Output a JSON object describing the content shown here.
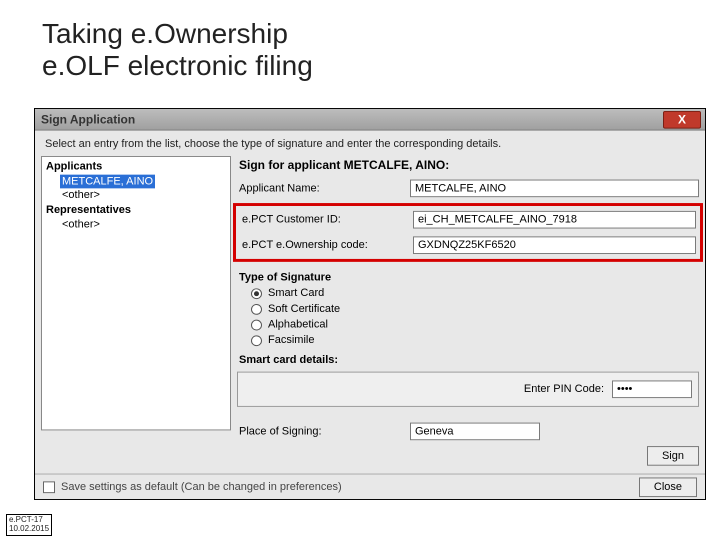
{
  "slide": {
    "title_line1": "Taking e.Ownership",
    "title_line2": "e.OLF electronic filing"
  },
  "window": {
    "title": "Sign Application",
    "instruction": "Select an entry from the list, choose the type of signature and enter the corresponding details."
  },
  "tree": {
    "applicants_label": "Applicants",
    "applicant_selected": "METCALFE, AINO",
    "other": "<other>",
    "reps_label": "Representatives"
  },
  "sign": {
    "heading": "Sign for applicant METCALFE, AINO:",
    "applicant_name_label": "Applicant Name:",
    "applicant_name_value": "METCALFE, AINO",
    "customer_id_label": "e.PCT Customer ID:",
    "customer_id_value": "ei_CH_METCALFE_AINO_7918",
    "ownership_code_label": "e.PCT e.Ownership code:",
    "ownership_code_value": "GXDNQZ25KF6520",
    "type_label": "Type of Signature",
    "radios": {
      "smart": "Smart Card",
      "soft": "Soft Certificate",
      "alpha": "Alphabetical",
      "fax": "Facsimile"
    },
    "details_label": "Smart card details:",
    "pin_label": "Enter PIN Code:",
    "pin_value": "****",
    "place_label": "Place of Signing:",
    "place_value": "Geneva",
    "sign_btn": "Sign"
  },
  "bottom": {
    "save_label": "Save settings as default (Can be changed in preferences)",
    "close_btn": "Close"
  },
  "footer": {
    "code": "e.PCT-17",
    "date": "10.02.2015"
  }
}
